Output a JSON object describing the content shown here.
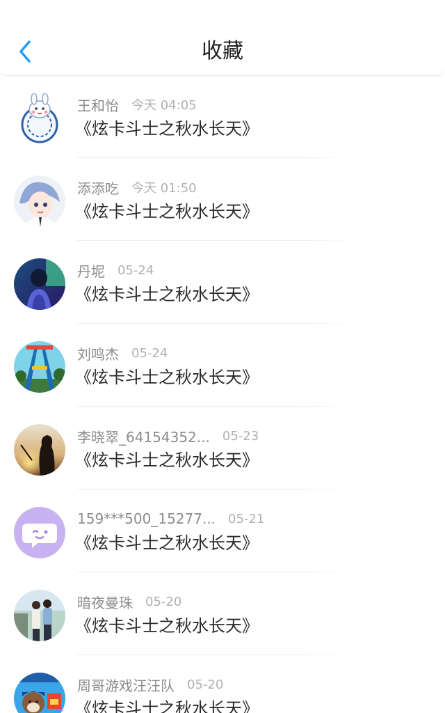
{
  "header": {
    "title": "收藏",
    "back_icon": "chevron-left-icon",
    "accent_color": "#1e9bff"
  },
  "items": [
    {
      "name": "王和怡",
      "time": "今天 04:05",
      "title": "《炫卡斗士之秋水长天》",
      "avatar": "rabbit-porcelain-avatar"
    },
    {
      "name": "添添吃",
      "time": "今天 01:50",
      "title": "《炫卡斗士之秋水长天》",
      "avatar": "anime-boy-avatar"
    },
    {
      "name": "丹坭",
      "time": "05-24",
      "title": "《炫卡斗士之秋水长天》",
      "avatar": "night-girl-avatar"
    },
    {
      "name": "刘鸣杰",
      "time": "05-24",
      "title": "《炫卡斗士之秋水长天》",
      "avatar": "amusement-ride-avatar"
    },
    {
      "name": "李晓翠_64154352...",
      "time": "05-23",
      "title": "《炫卡斗士之秋水长天》",
      "avatar": "sunset-silhouette-avatar"
    },
    {
      "name": "159***500_15277...",
      "time": "05-21",
      "title": "《炫卡斗士之秋水长天》",
      "avatar": "chat-bubble-avatar"
    },
    {
      "name": "暗夜曼珠",
      "time": "05-20",
      "title": "《炫卡斗士之秋水长天》",
      "avatar": "couple-photo-avatar"
    },
    {
      "name": "周哥游戏汪汪队",
      "time": "05-20",
      "title": "《炫卡斗士之秋水长天》",
      "avatar": "paw-patrol-avatar"
    }
  ]
}
